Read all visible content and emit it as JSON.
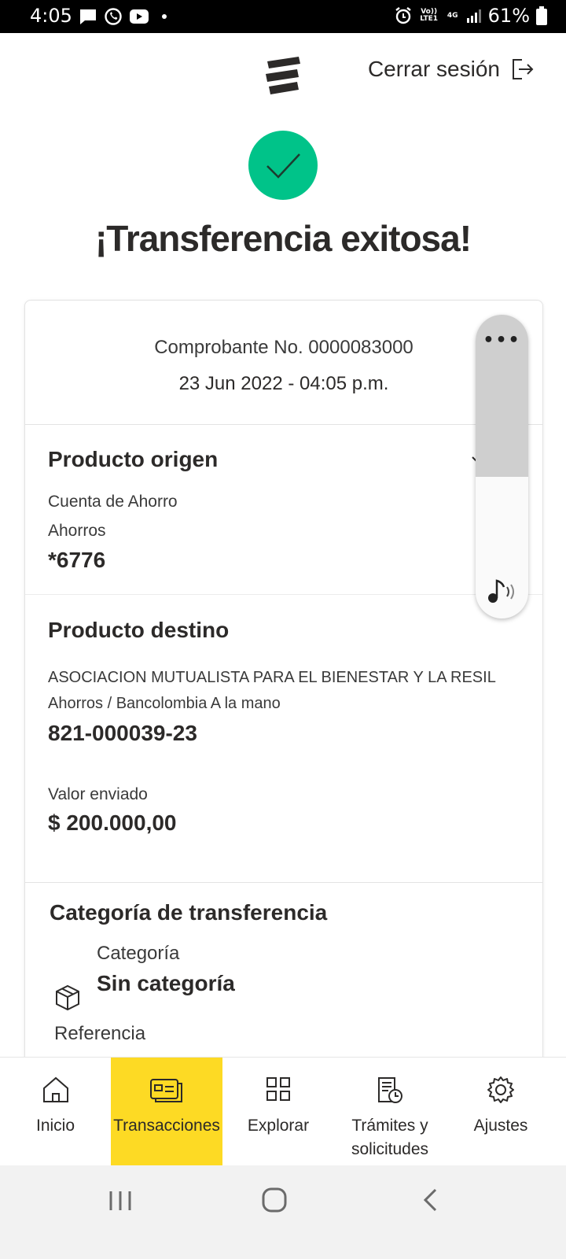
{
  "status_bar": {
    "time": "4:05",
    "battery": "61%",
    "network": "4G",
    "volte": "Vo)) LTE1"
  },
  "header": {
    "logout_label": "Cerrar sesión"
  },
  "result": {
    "title": "¡Transferencia exitosa!"
  },
  "receipt": {
    "number": "Comprobante No. 0000083000",
    "datetime": "23 Jun 2022 - 04:05 p.m."
  },
  "origin": {
    "heading": "Producto origen",
    "account_type": "Cuenta de Ahorro",
    "product": "Ahorros",
    "number": "*6776"
  },
  "destination": {
    "heading": "Producto destino",
    "holder": "ASOCIACION MUTUALISTA PARA EL BIENESTAR Y LA RESIL",
    "product": "Ahorros / Bancolombia A la mano",
    "number": "821-000039-23",
    "amount_label": "Valor enviado",
    "amount": "$ 200.000,00"
  },
  "category": {
    "heading": "Categoría de transferencia",
    "label": "Categoría",
    "value": "Sin categoría",
    "reference_label": "Referencia"
  },
  "bottom_nav": {
    "items": [
      {
        "label": "Inicio",
        "icon": "home-icon"
      },
      {
        "label": "Transacciones",
        "icon": "card-icon",
        "active": true
      },
      {
        "label": "Explorar",
        "icon": "grid-icon"
      },
      {
        "label": "Trámites y solicitudes",
        "icon": "document-icon"
      },
      {
        "label": "Ajustes",
        "icon": "gear-icon"
      }
    ]
  },
  "colors": {
    "success": "#00c389",
    "accent": "#fdda24",
    "text": "#2c2a29"
  }
}
